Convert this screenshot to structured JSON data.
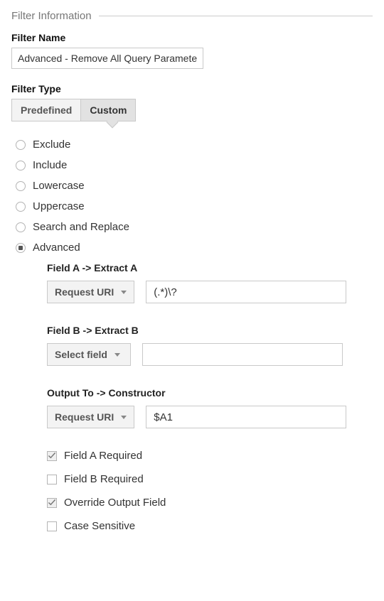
{
  "legend": "Filter Information",
  "filterName": {
    "label": "Filter Name",
    "value": "Advanced - Remove All Query Parameters"
  },
  "filterType": {
    "label": "Filter Type",
    "tabs": {
      "predefined": "Predefined",
      "custom": "Custom"
    }
  },
  "radios": {
    "exclude": "Exclude",
    "include": "Include",
    "lowercase": "Lowercase",
    "uppercase": "Uppercase",
    "search_replace": "Search and Replace",
    "advanced": "Advanced"
  },
  "advanced": {
    "fieldA": {
      "title": "Field A -> Extract A",
      "dropdown": "Request URI",
      "value": "(.*)\\?"
    },
    "fieldB": {
      "title": "Field B -> Extract B",
      "dropdown": "Select field",
      "value": ""
    },
    "output": {
      "title": "Output To -> Constructor",
      "dropdown": "Request URI",
      "value": "$A1"
    },
    "checks": {
      "fieldA_required": "Field A Required",
      "fieldB_required": "Field B Required",
      "override_output": "Override Output Field",
      "case_sensitive": "Case Sensitive"
    }
  }
}
